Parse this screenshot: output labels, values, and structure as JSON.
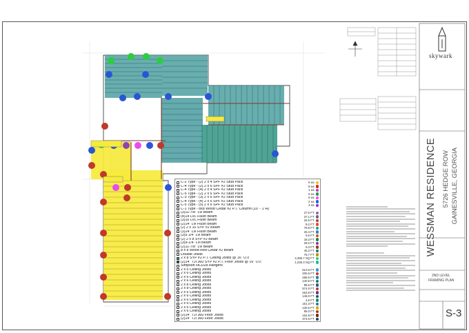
{
  "project": {
    "title": "WESSMAN RESIDENCE",
    "address_line1": "5726 HEDGE ROW",
    "address_line2": "GAINESVILLE, GEORGIA"
  },
  "firm": {
    "name": "skywark"
  },
  "sheet": {
    "name_line1": "2ND LEVEL",
    "name_line2": "FRAMING PLAN",
    "number": "S-3"
  },
  "legend": {
    "items": [
      {
        "label": "C-2 Type - (2) 2 x 4 SPF #2 Stud Pack",
        "value": "6 ea",
        "marker": "#f2c200",
        "swatch": "#ffffff"
      },
      {
        "label": "C-4 Type - (2) 2 x 6 SPF #2 Stud Pack",
        "value": "8 ea",
        "marker": "#e02020",
        "swatch": "#ffffff"
      },
      {
        "label": "C-4 Type - (4) 2 x 4 SPF #2 Stud Pack",
        "value": "1 ea",
        "marker": "#b040c0",
        "swatch": "#ffffff"
      },
      {
        "label": "C-5 Type - (2) 2 x 6 SPF #2 Stud Pack",
        "value": "5 ea",
        "marker": "#2a9a4a",
        "swatch": "#ffffff"
      },
      {
        "label": "C-3 Type - (3) 2 x 6 SPF #2 Stud Pack",
        "value": "5 ea",
        "marker": "#ff40ff",
        "swatch": "#ffffff"
      },
      {
        "label": "C-4 Type - (4) 2 x 6 SPF #2 Stud Pack",
        "value": "2 ea",
        "marker": "#2060d0",
        "swatch": "#ffffff"
      },
      {
        "label": "C-5 Type - (5) 2 x 6 SPF #2 Stud Pack",
        "value": "3 ea",
        "marker": "#8a2be2",
        "swatch": "#ffffff"
      },
      {
        "label": "C-1 Type - 8x8 Wood Cedar #2 P.T. Column (10' - 1\"H)",
        "value": "",
        "marker": "",
        "swatch": "#ffffff"
      },
      {
        "label": "(3)11-7/8\" Lvl Beam",
        "value": "27.6 FT",
        "marker": "#9b59b6",
        "swatch": "#ffffff"
      },
      {
        "label": "(4)14 LVL Flush Beam",
        "value": "37.1 FT",
        "marker": "#5d6d7e",
        "swatch": "#ffffff"
      },
      {
        "label": "(3)16 LVL Flush Beam",
        "value": "34.5 FT",
        "marker": "#c0392b",
        "swatch": "#ffffff"
      },
      {
        "label": "(2)14\" Lvl Flush Beam",
        "value": "8.2 FT",
        "marker": "#e74c3c",
        "swatch": "#ffffff"
      },
      {
        "label": "(2) 2 x 10 SYP #2 Beam",
        "value": "78.8 FT",
        "marker": "#16a085",
        "swatch": "#ffffff"
      },
      {
        "label": "(3)14\" Lvl Flush Beam",
        "value": "33.4 FT",
        "marker": "#2e86c1",
        "swatch": "#ffffff"
      },
      {
        "label": "(3)9 1/4\" Lvl Beam",
        "value": "9.6 FT",
        "marker": "#d35400",
        "swatch": "#ffffff"
      },
      {
        "label": "(2) 2 x 8 SYP #2 Beam",
        "value": "18.3 FT",
        "marker": "#1e8449",
        "swatch": "#ffffff"
      },
      {
        "label": "(3)9-1/4\" Lvl Beam",
        "value": "29.2 FT",
        "marker": "#7d3c98",
        "swatch": "#ffffff"
      },
      {
        "label": "(2)11-7/8\" Lvl Beam",
        "value": "9.3 FT",
        "marker": "#a93226",
        "swatch": "#ffffff"
      },
      {
        "label": "8 x 8 Wood Red Cedar #2 Beam",
        "value": "45.2 FT",
        "marker": "#117a65",
        "swatch": "#ffffff"
      },
      {
        "label": "Double Joists",
        "value": "75.7 FT",
        "marker": "#b7950b",
        "swatch": "#ffffff"
      },
      {
        "label": "2 x 8 SYP #2 P.T. Ceiling Joists @ 16\" O.c",
        "value": "2,495.7 SQ FT",
        "marker": "#2ecc71",
        "swatch": "#2f9e3a"
      },
      {
        "label": "(2)14\" TJI 360 SYP #2 P.T. Floor Joists @ 16\" O.c",
        "value": "1,236.3 SQ FT",
        "marker": "#1abc9c",
        "swatch": "#1e5f45"
      },
      {
        "label": "Simpson HCU28 Hangers",
        "value": "",
        "marker": "",
        "swatch": "#ffffff"
      },
      {
        "label": "2 x 6 Ceiling Joists",
        "value": "513.6 FT",
        "marker": "#3498db",
        "swatch": "#ffffff"
      },
      {
        "label": "2 x 6 Ceiling Joists",
        "value": "206.6 FT",
        "marker": "#c0392b",
        "swatch": "#ffffff"
      },
      {
        "label": "2 x 6 Ceiling Joists",
        "value": "289.5 FT",
        "marker": "#2980b9",
        "swatch": "#ffffff"
      },
      {
        "label": "2 x 6 Ceiling Joists",
        "value": "140.5 FT",
        "marker": "#117864",
        "swatch": "#ffffff"
      },
      {
        "label": "2 x 8 Ceiling Joists",
        "value": "98.6 FT",
        "marker": "#1f618d",
        "swatch": "#ffffff"
      },
      {
        "label": "2 x 8 Ceiling Joists",
        "value": "574.0 FT",
        "marker": "#b03a2e",
        "swatch": "#ffffff"
      },
      {
        "label": "2 x 6 Ceiling Joists",
        "value": "263.8 FT",
        "marker": "#6c3483",
        "swatch": "#ffffff"
      },
      {
        "label": "2 x 6 Ceiling Joists",
        "value": "148.0 FT",
        "marker": "#1a5276",
        "swatch": "#ffffff"
      },
      {
        "label": "2 x 6 Ceiling Joists",
        "value": "4.6 FT",
        "marker": "#148f77",
        "swatch": "#ffffff"
      },
      {
        "label": "2 x 6 Ceiling Joists",
        "value": "151.3 FT",
        "marker": "#2874a6",
        "swatch": "#ffffff"
      },
      {
        "label": "2 x 6 Ceiling Joists",
        "value": "130.6 FT",
        "marker": "#d4ac0d",
        "swatch": "#ffffff"
      },
      {
        "label": "2 x 6 Ceiling Joists",
        "value": "96.0 FT",
        "marker": "#a04000",
        "swatch": "#ffffff"
      },
      {
        "label": "(2)14\" TJI 360 Floor Joists",
        "value": "164.8 FT",
        "marker": "#7b241c",
        "swatch": "#ffffff"
      },
      {
        "label": "(2)14\" TJI 360 Floor Joists",
        "value": "374.5 FT",
        "marker": "#154360",
        "swatch": "#ffffff"
      }
    ]
  },
  "colors": {
    "floor_yellow": "#f6ea3c",
    "roof_teal": "#4fa0a0",
    "roof_green": "#3d9a88",
    "marker_red": "#c0392b",
    "marker_blue": "#2a56d6",
    "marker_green": "#2ecc40",
    "marker_purple": "#8e44ad",
    "marker_magenta": "#e84cf0"
  }
}
